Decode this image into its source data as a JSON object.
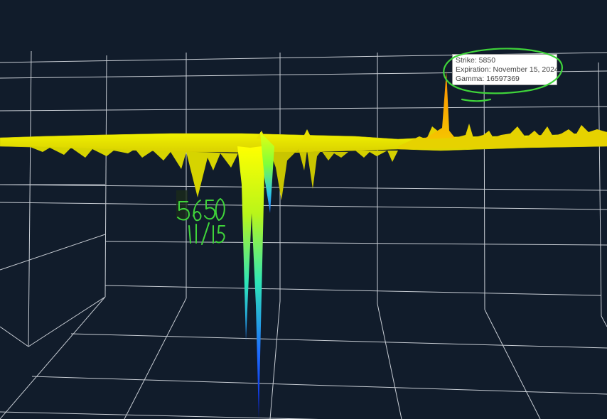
{
  "chart_data": {
    "type": "surface",
    "description_colorscale": [
      "#0a1fd6",
      "#1e90ff",
      "#2ee6c8",
      "#7fff3a",
      "#d8f000",
      "#ffff00",
      "#f5b800",
      "#ff8c00"
    ],
    "grid": true,
    "background": "#111c2b",
    "hover": {
      "strike_label": "Strike",
      "strike": "5850",
      "expiration_label": "Expiration",
      "expiration": "November 15, 2024",
      "gamma_label": "Gamma",
      "gamma": "16597369"
    },
    "notable_points": [
      {
        "strike": "5850",
        "expiration": "November 15, 2024",
        "gamma": 16597369,
        "direction": "positive-spike"
      },
      {
        "strike": "5650",
        "expiration": "11/15",
        "direction": "negative-spike"
      }
    ]
  },
  "tooltip": {
    "line1": "Strike: 5850",
    "line2": "Expiration: November 15, 2024",
    "line3": "Gamma: 16597369"
  },
  "annotations": {
    "handwritten_strike": "5650",
    "handwritten_date": "11/15",
    "ink_color": "#3fd43a"
  }
}
